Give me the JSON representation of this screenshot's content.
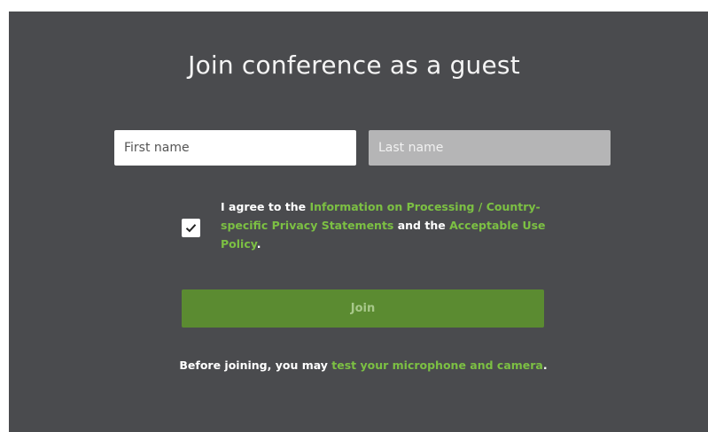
{
  "form": {
    "title": "Join conference as a guest",
    "first_name_placeholder": "First name",
    "last_name_placeholder": "Last name",
    "consent": {
      "checked": true,
      "prefix": "I agree to the ",
      "link1": "Information on Processing / Country-specific Privacy Statements",
      "middle": " and the ",
      "link2": "Acceptable Use Policy",
      "suffix": "."
    },
    "join_label": "Join",
    "footer": {
      "prefix": "Before joining, you may ",
      "link": "test your microphone and camera",
      "suffix": "."
    }
  },
  "colors": {
    "panel_bg": "#4a4b4e",
    "accent_link": "#7cc043",
    "join_button": "#5b8b31"
  },
  "icons": {
    "checkbox": "checkmark-icon"
  }
}
